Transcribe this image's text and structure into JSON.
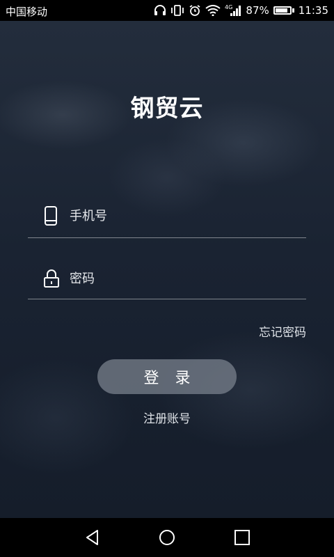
{
  "status_bar": {
    "carrier": "中国移动",
    "network": "4G",
    "battery": "87%",
    "battery_level": 0.87,
    "time": "11:35",
    "icons": [
      "headphones-icon",
      "vibrate-icon",
      "alarm-icon",
      "wifi-icon",
      "signal-icon",
      "battery-icon"
    ]
  },
  "app": {
    "title": "钢贸云"
  },
  "form": {
    "phone_placeholder": "手机号",
    "password_placeholder": "密码",
    "phone_icon": "phone-icon",
    "password_icon": "lock-icon"
  },
  "links": {
    "forgot_password": "忘记密码",
    "register": "注册账号"
  },
  "buttons": {
    "login": "登 录"
  },
  "nav_bar": {
    "icons": [
      "back-icon",
      "home-icon",
      "recent-apps-icon"
    ]
  },
  "colors": {
    "background": "#1b2433",
    "status_bar": "#000000",
    "button": "#7a808c",
    "divider": "#8d939c"
  }
}
